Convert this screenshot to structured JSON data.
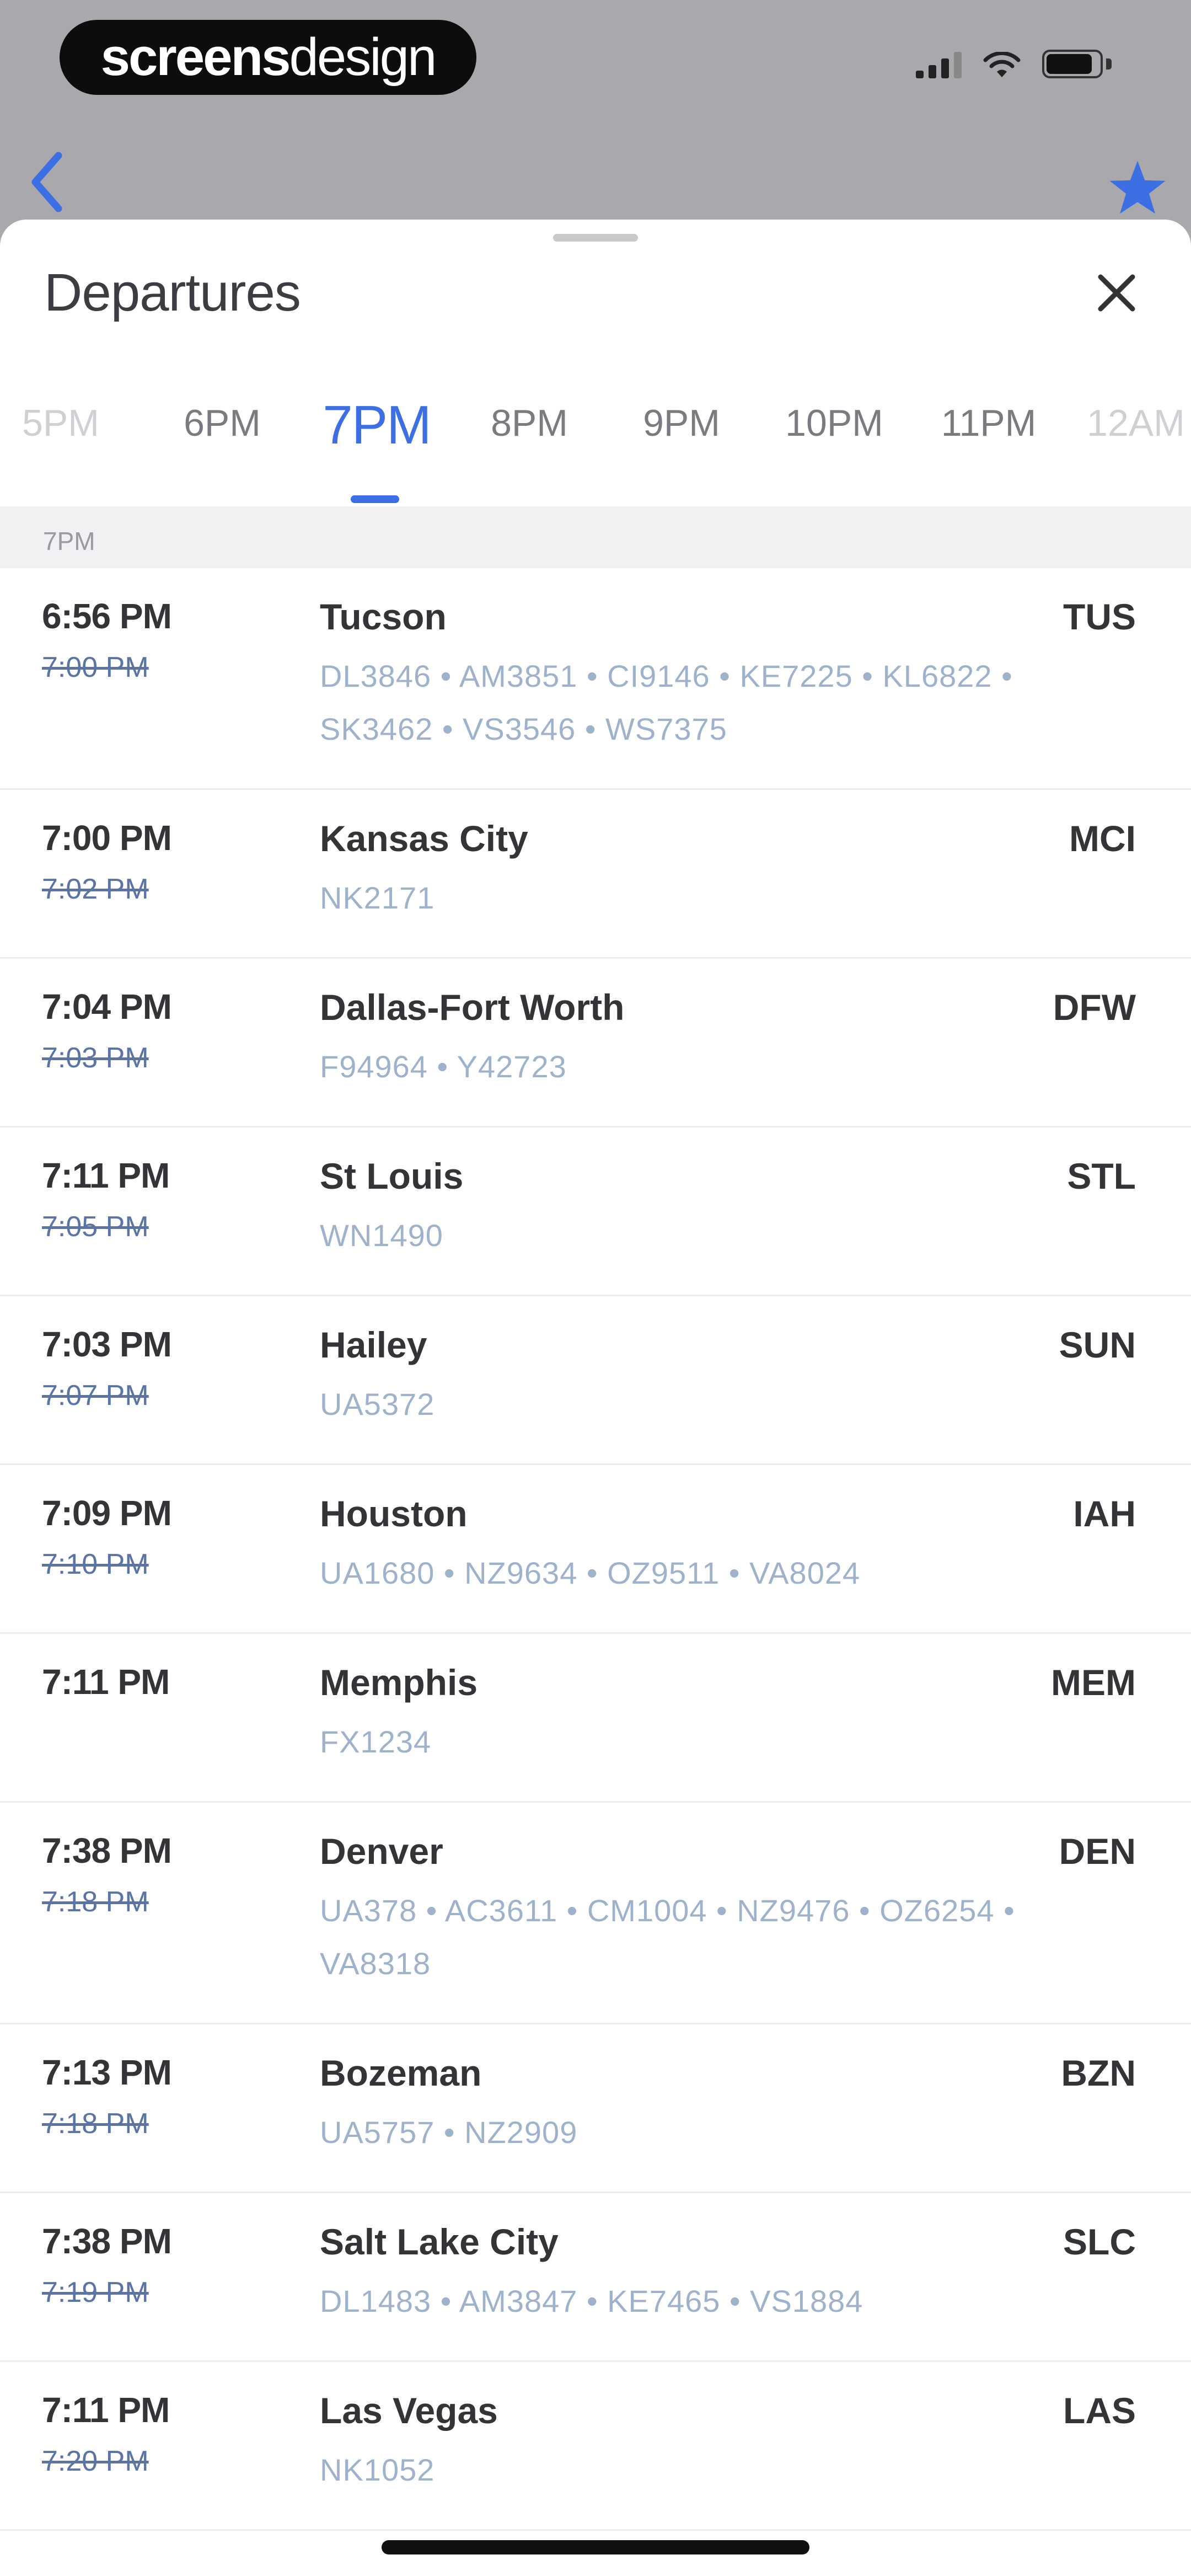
{
  "status_bar": {
    "brand_bold": "screens",
    "brand_light": "design"
  },
  "sheet": {
    "title": "Departures",
    "close_icon": "close-icon"
  },
  "hour_tabs": [
    "5PM",
    "6PM",
    "7PM",
    "8PM",
    "9PM",
    "10PM",
    "11PM",
    "12AM"
  ],
  "active_hour": "7PM",
  "section": {
    "label": "7PM"
  },
  "colors": {
    "accent": "#3b6fe3",
    "flight_codes": "#9fb2cc",
    "scheduled_struck": "#5a74a6"
  },
  "departures": [
    {
      "time": "6:56 PM",
      "scheduled": "7:00 PM",
      "city": "Tucson",
      "code": "TUS",
      "flights": [
        "DL3846",
        "AM3851",
        "CI9146",
        "KE7225",
        "KL6822",
        "SK3462",
        "VS3546",
        "WS7375"
      ]
    },
    {
      "time": "7:00 PM",
      "scheduled": "7:02 PM",
      "city": "Kansas City",
      "code": "MCI",
      "flights": [
        "NK2171"
      ]
    },
    {
      "time": "7:04 PM",
      "scheduled": "7:03 PM",
      "city": "Dallas-Fort Worth",
      "code": "DFW",
      "flights": [
        "F94964",
        "Y42723"
      ]
    },
    {
      "time": "7:11 PM",
      "scheduled": "7:05 PM",
      "city": "St Louis",
      "code": "STL",
      "flights": [
        "WN1490"
      ]
    },
    {
      "time": "7:03 PM",
      "scheduled": "7:07 PM",
      "city": "Hailey",
      "code": "SUN",
      "flights": [
        "UA5372"
      ]
    },
    {
      "time": "7:09 PM",
      "scheduled": "7:10 PM",
      "city": "Houston",
      "code": "IAH",
      "flights": [
        "UA1680",
        "NZ9634",
        "OZ9511",
        "VA8024"
      ]
    },
    {
      "time": "7:11 PM",
      "scheduled": "",
      "city": "Memphis",
      "code": "MEM",
      "flights": [
        "FX1234"
      ]
    },
    {
      "time": "7:38 PM",
      "scheduled": "7:18 PM",
      "city": "Denver",
      "code": "DEN",
      "flights": [
        "UA378",
        "AC3611",
        "CM1004",
        "NZ9476",
        "OZ6254",
        "VA8318"
      ]
    },
    {
      "time": "7:13 PM",
      "scheduled": "7:18 PM",
      "city": "Bozeman",
      "code": "BZN",
      "flights": [
        "UA5757",
        "NZ2909"
      ]
    },
    {
      "time": "7:38 PM",
      "scheduled": "7:19 PM",
      "city": "Salt Lake City",
      "code": "SLC",
      "flights": [
        "DL1483",
        "AM3847",
        "KE7465",
        "VS1884"
      ]
    },
    {
      "time": "7:11 PM",
      "scheduled": "7:20 PM",
      "city": "Las Vegas",
      "code": "LAS",
      "flights": [
        "NK1052"
      ]
    }
  ]
}
